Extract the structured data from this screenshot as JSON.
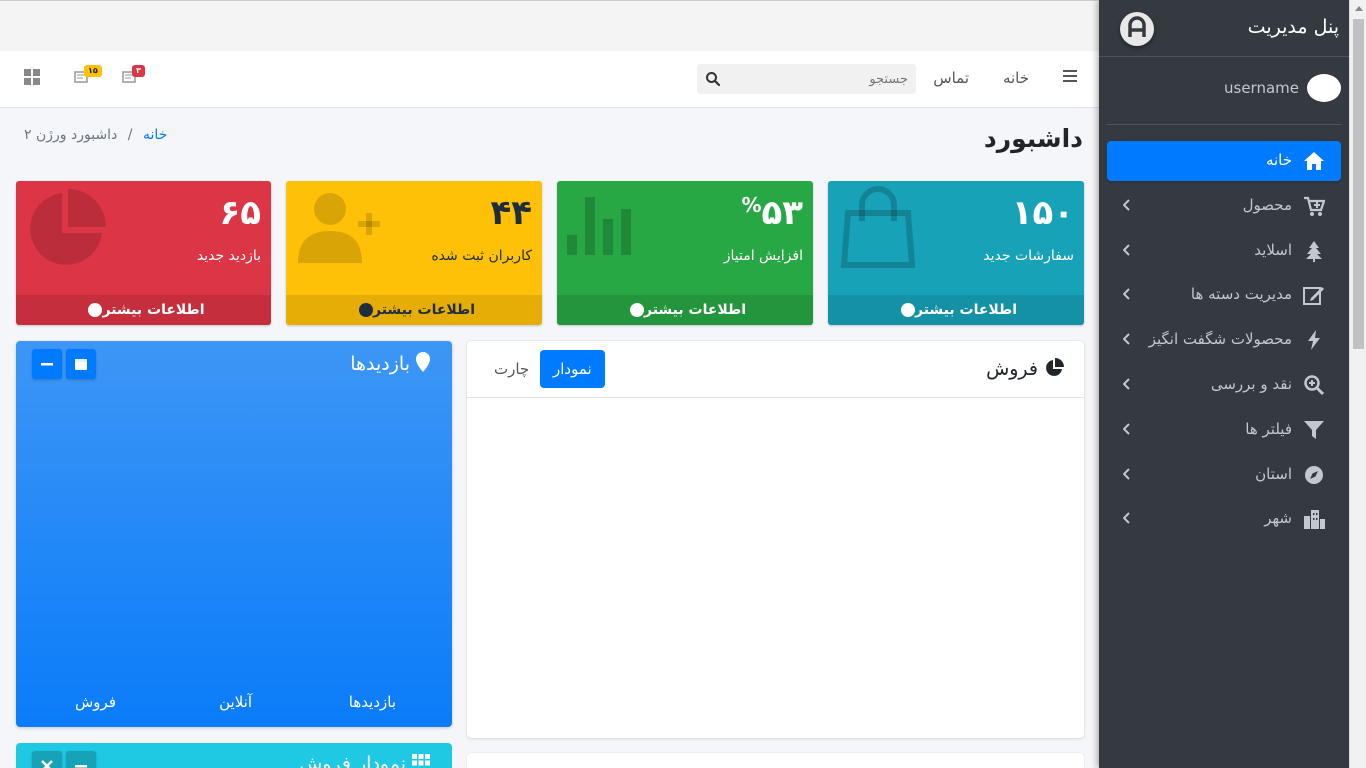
{
  "navbar": {
    "home": "خانه",
    "contact": "تماس",
    "search_placeholder": "جستجو",
    "messages_badge": "۳",
    "notifications_badge": "۱۵"
  },
  "header": {
    "title": "داشبورد",
    "breadcrumb_home": "خانه",
    "breadcrumb_current": "داشبورد ورژن ۲"
  },
  "boxes": [
    {
      "value": "۱۵۰",
      "label": "سفارشات جدید",
      "more": "اطلاعات بیشتر",
      "color": "#17a2b8"
    },
    {
      "value": "۵۳",
      "unit": "%",
      "label": "افزایش امتیاز",
      "more": "اطلاعات بیشتر",
      "color": "#28a745"
    },
    {
      "value": "۴۴",
      "label": "کاربران ثبت شده",
      "more": "اطلاعات بیشتر",
      "color": "#ffc107"
    },
    {
      "value": "۶۵",
      "label": "بازدید جدید",
      "more": "اطلاعات بیشتر",
      "color": "#dc3545"
    }
  ],
  "sales_card": {
    "title": "فروش",
    "tab_active": "نمودار",
    "tab_inactive": "چارت"
  },
  "visits_card": {
    "title": "بازدیدها",
    "footer": [
      "بازدیدها",
      "آنلاین",
      "فروش"
    ]
  },
  "teal_card": {
    "title": "نمودار فروش"
  },
  "sidebar": {
    "brand": "پنل مدیریت",
    "username": "username",
    "items": [
      {
        "label": "خانه",
        "icon": "home-icon"
      },
      {
        "label": "محصول",
        "icon": "cart-icon"
      },
      {
        "label": "اسلاید",
        "icon": "tree-icon"
      },
      {
        "label": "مدیریت دسته ها",
        "icon": "edit-icon"
      },
      {
        "label": "محصولات شگفت انگیز",
        "icon": "bolt-icon"
      },
      {
        "label": "نقد و بررسی",
        "icon": "search-plus-icon"
      },
      {
        "label": "فیلتر ها",
        "icon": "filter-icon"
      },
      {
        "label": "استان",
        "icon": "compass-icon"
      },
      {
        "label": "شهر",
        "icon": "city-icon"
      }
    ]
  },
  "colors": {
    "primary": "#007bff",
    "sidebar_bg": "#343a40"
  }
}
